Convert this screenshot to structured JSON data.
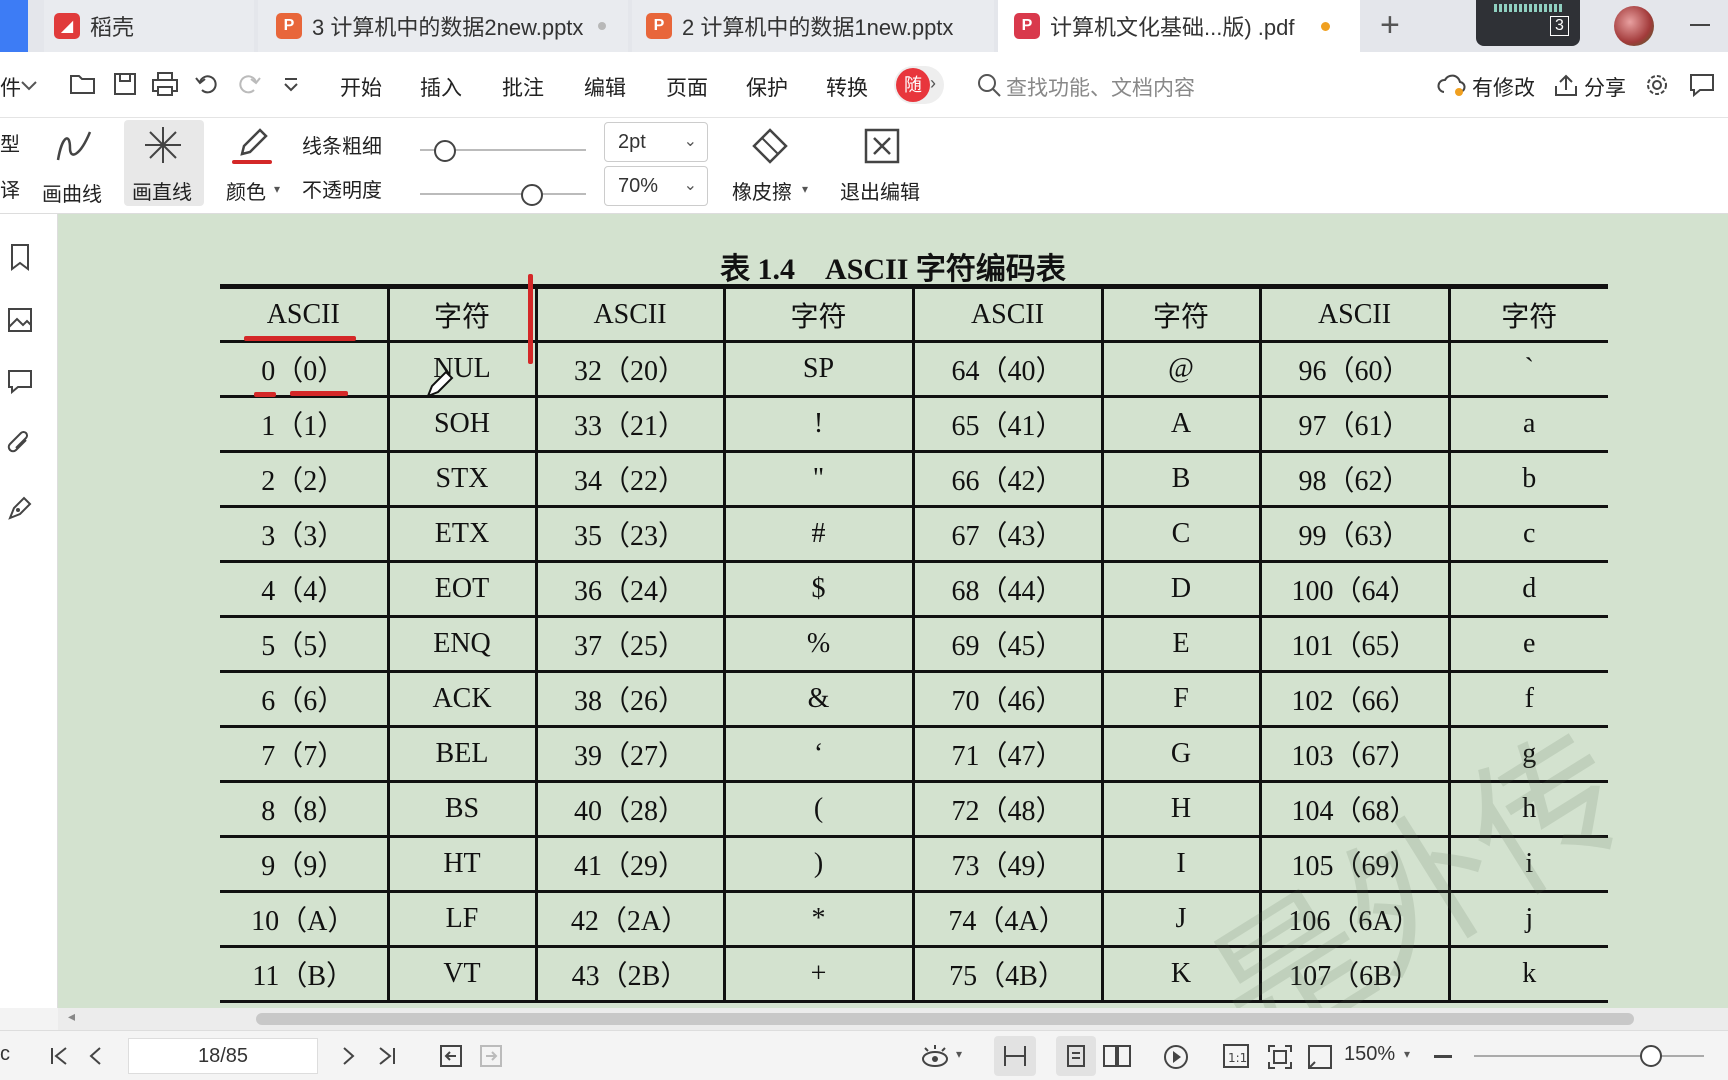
{
  "tabs": [
    {
      "label": "稻壳",
      "icon": "docer-icon"
    },
    {
      "label": "3 计算机中的数据2new.pptx",
      "icon": "pptx-icon"
    },
    {
      "label": "2 计算机中的数据1new.pptx",
      "icon": "pptx-icon"
    },
    {
      "label": "计算机文化基础...版) .pdf",
      "icon": "pdf-icon",
      "active": true
    }
  ],
  "tab_counter": "3",
  "menu": {
    "items": [
      "开始",
      "插入",
      "批注",
      "编辑",
      "页面",
      "保护",
      "转换"
    ],
    "search_placeholder": "查找功能、文档内容",
    "modified": "有修改",
    "share": "分享",
    "left_cut": "件",
    "badge": "随"
  },
  "toolbar": {
    "draw_curve": "画曲线",
    "draw_line": "画直线",
    "color": "颜色",
    "line_width_label": "线条粗细",
    "opacity_label": "不透明度",
    "line_width_value": "2pt",
    "opacity_value": "70%",
    "eraser": "橡皮擦",
    "exit_edit": "退出编辑",
    "left_cut_1": "型",
    "left_cut_2": "译",
    "line_width_level": 0.1,
    "opacity_level": 0.7
  },
  "table": {
    "title": "表 1.4　ASCII 字符编码表",
    "headers": [
      "ASCII",
      "字符",
      "ASCII",
      "字符",
      "ASCII",
      "字符",
      "ASCII",
      "字符"
    ],
    "rows": [
      [
        "0（0）",
        "NUL",
        "32（20）",
        "SP",
        "64（40）",
        "@",
        "96（60）",
        "`"
      ],
      [
        "1（1）",
        "SOH",
        "33（21）",
        "!",
        "65（41）",
        "A",
        "97（61）",
        "a"
      ],
      [
        "2（2）",
        "STX",
        "34（22）",
        "\"",
        "66（42）",
        "B",
        "98（62）",
        "b"
      ],
      [
        "3（3）",
        "ETX",
        "35（23）",
        "#",
        "67（43）",
        "C",
        "99（63）",
        "c"
      ],
      [
        "4（4）",
        "EOT",
        "36（24）",
        "$",
        "68（44）",
        "D",
        "100（64）",
        "d"
      ],
      [
        "5（5）",
        "ENQ",
        "37（25）",
        "%",
        "69（45）",
        "E",
        "101（65）",
        "e"
      ],
      [
        "6（6）",
        "ACK",
        "38（26）",
        "&",
        "70（46）",
        "F",
        "102（66）",
        "f"
      ],
      [
        "7（7）",
        "BEL",
        "39（27）",
        "‘",
        "71（47）",
        "G",
        "103（67）",
        "g"
      ],
      [
        "8（8）",
        "BS",
        "40（28）",
        "(",
        "72（48）",
        "H",
        "104（68）",
        "h"
      ],
      [
        "9（9）",
        "HT",
        "41（29）",
        ")",
        "73（49）",
        "I",
        "105（69）",
        "i"
      ],
      [
        "10（A）",
        "LF",
        "42（2A）",
        "*",
        "74（4A）",
        "J",
        "106（6A）",
        "j"
      ],
      [
        "11（B）",
        "VT",
        "43（2B）",
        "+",
        "75（4B）",
        "K",
        "107（6B）",
        "k"
      ]
    ]
  },
  "watermark": "是外传",
  "status": {
    "page": "18/85",
    "zoom": "150%",
    "zoom_level": 0.8,
    "left_cut": "c"
  },
  "colors": {
    "accent": "#d42828",
    "page_bg": "#d3e2cf",
    "active_tab_dot": "#f0a020"
  }
}
